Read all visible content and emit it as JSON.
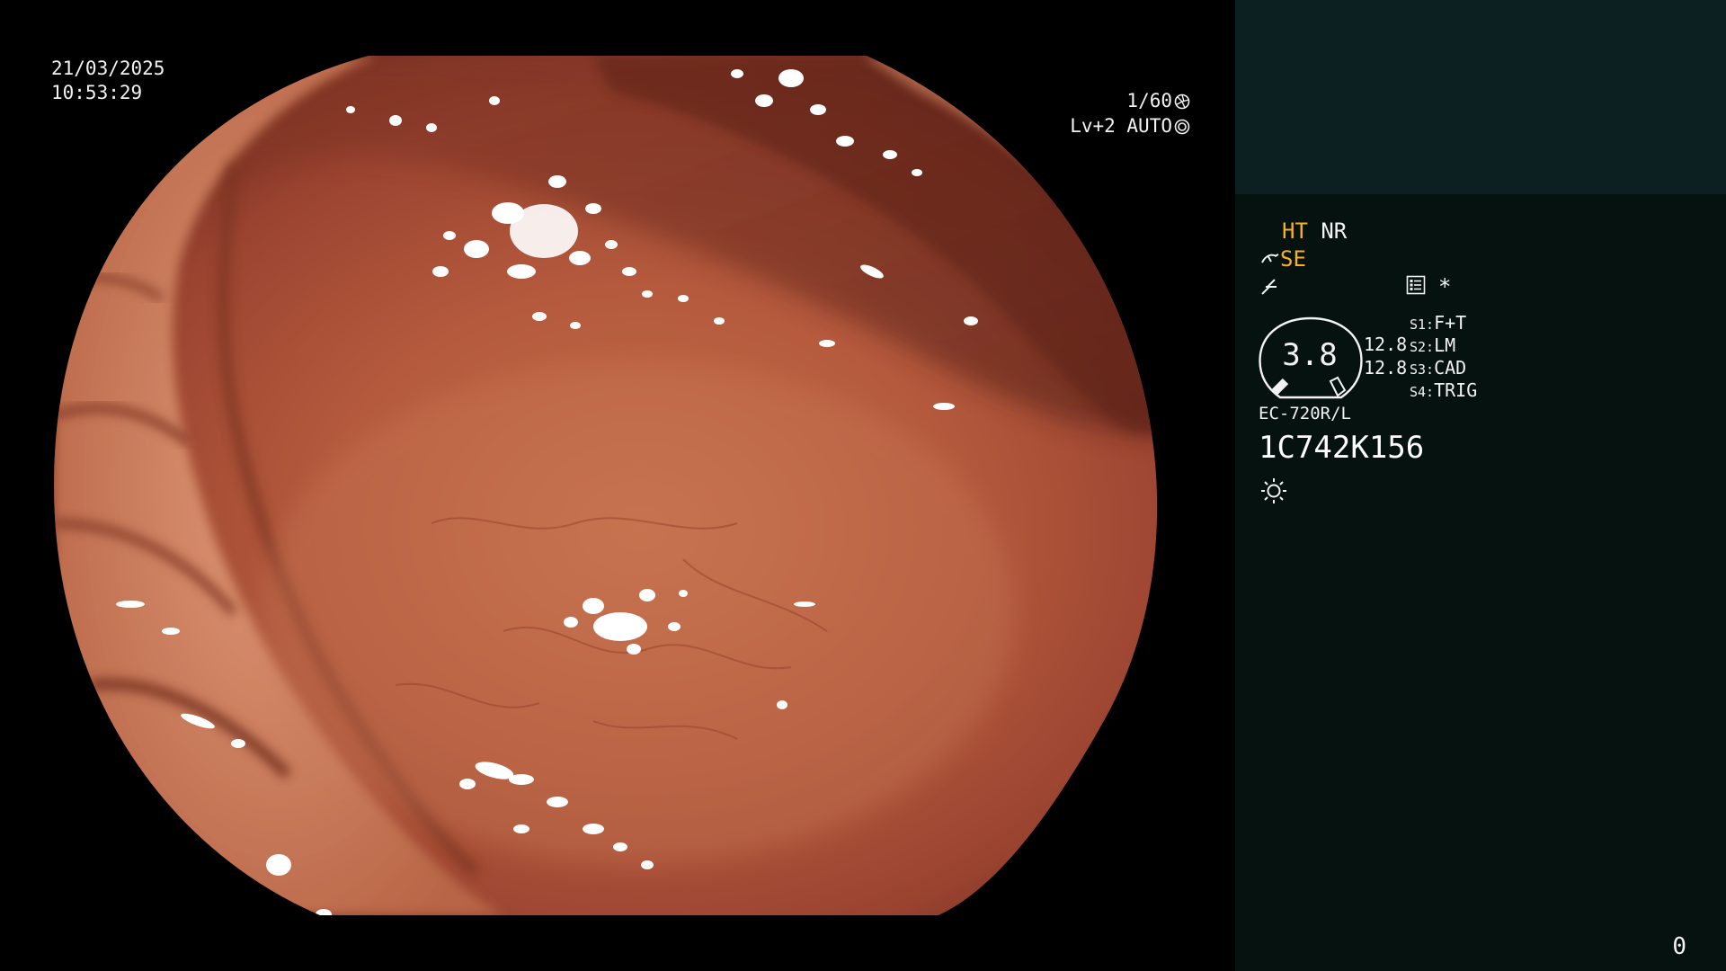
{
  "overlay": {
    "date": "21/03/2025",
    "time": "10:53:29",
    "shutter": "1/60",
    "exposure": "Lv+2 AUTO"
  },
  "panel": {
    "mode_1_left": "HT",
    "mode_1_right": "NR",
    "mode_2": "SE",
    "gauge_value": "3.8",
    "values": [
      "12.8",
      "12.8"
    ],
    "switches": [
      {
        "key": "S1:",
        "label": "F+T"
      },
      {
        "key": "S2:",
        "label": "LM"
      },
      {
        "key": "S3:",
        "label": "CAD"
      },
      {
        "key": "S4:",
        "label": "TRIG"
      }
    ],
    "asterisk": "*",
    "scope_model": "EC-720R/L",
    "scope_serial": "1C742K156",
    "counter": "0"
  },
  "colors": {
    "panel_bg": "#051210",
    "panel_header_bg": "#0c2022",
    "highlight": "#f6b21f",
    "mucosa": "#b0553a"
  },
  "icons": {
    "shutter": "aperture-icon",
    "exposure": "iris-icon",
    "mode_2": "scope-tip-icon",
    "mode_3": "waveform-icon",
    "record": "record-list-icon",
    "light": "light-source-icon"
  }
}
